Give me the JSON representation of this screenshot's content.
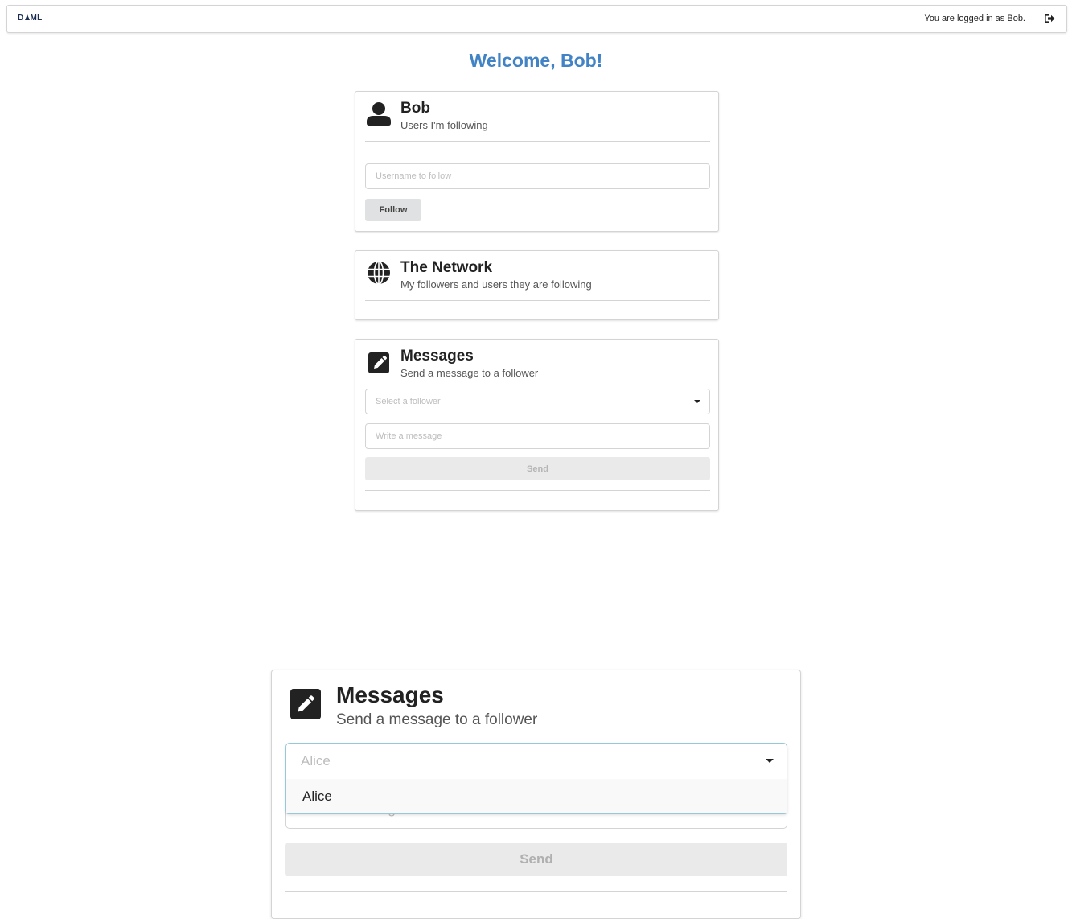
{
  "header": {
    "brand": "DAML",
    "brand_parts": [
      "D",
      "ML"
    ],
    "logged_in_text": "You are logged in as Bob.",
    "logout_icon": "sign-out-icon"
  },
  "welcome": "Welcome, Bob!",
  "follow_card": {
    "icon": "user-icon",
    "title": "Bob",
    "subtitle": "Users I'm following",
    "input_placeholder": "Username to follow",
    "button_label": "Follow"
  },
  "network_card": {
    "icon": "globe-icon",
    "title": "The Network",
    "subtitle": "My followers and users they are following"
  },
  "messages_card": {
    "icon": "edit-icon",
    "title": "Messages",
    "subtitle": "Send a message to a follower",
    "select_placeholder": "Select a follower",
    "message_placeholder": "Write a message",
    "send_label": "Send"
  },
  "zoom_panel": {
    "title": "Messages",
    "subtitle": "Send a message to a follower",
    "select_value": "Alice",
    "options": [
      "Alice"
    ],
    "message_placeholder": "Write a message",
    "send_label": "Send"
  }
}
